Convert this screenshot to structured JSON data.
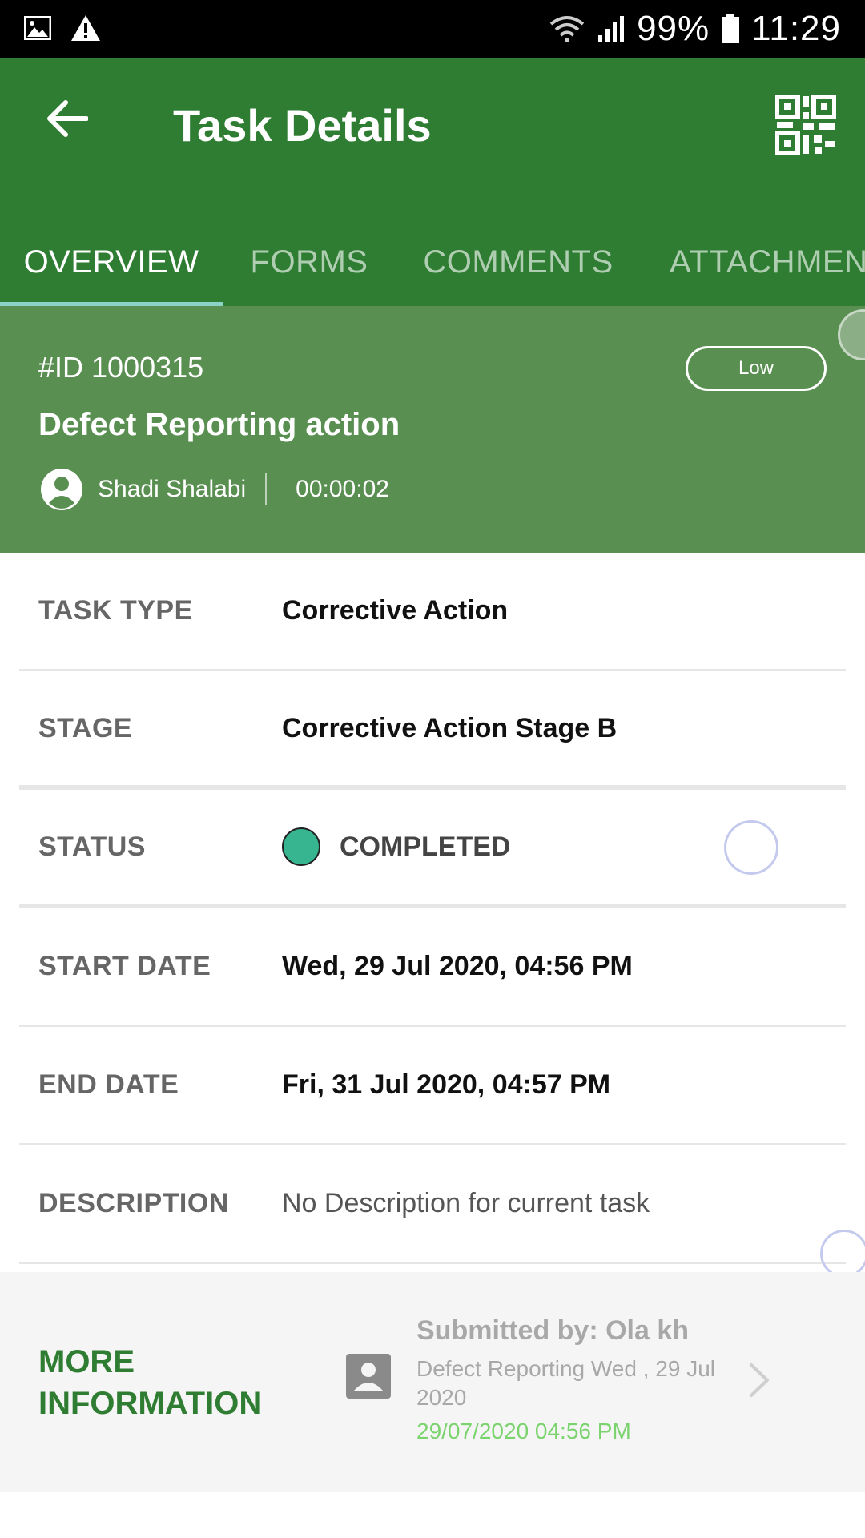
{
  "status_bar": {
    "battery": "99%",
    "time": "11:29",
    "icons": [
      "image-icon",
      "warning-icon",
      "wifi-icon",
      "signal-icon",
      "battery-icon"
    ]
  },
  "app_bar": {
    "title": "Task Details",
    "tabs": [
      {
        "label": "OVERVIEW",
        "active": true
      },
      {
        "label": "FORMS",
        "active": false
      },
      {
        "label": "COMMENTS",
        "active": false
      },
      {
        "label": "ATTACHMEN",
        "active": false
      }
    ]
  },
  "task": {
    "id": "#ID 1000315",
    "name": "Defect Reporting action",
    "priority": "Low",
    "owner": "Shadi Shalabi",
    "timer": "00:00:02"
  },
  "details": [
    {
      "label": "TASK TYPE",
      "value": "Corrective Action"
    },
    {
      "label": "STAGE",
      "value": "Corrective Action Stage B"
    },
    {
      "label": "STATUS",
      "value": "COMPLETED"
    },
    {
      "label": "START DATE",
      "value": "Wed, 29 Jul 2020, 04:56 PM"
    },
    {
      "label": "END DATE",
      "value": "Fri, 31 Jul 2020, 04:57 PM"
    },
    {
      "label": "DESCRIPTION",
      "value": "No Description for current task"
    }
  ],
  "more_info": {
    "label": "MORE INFORMATION",
    "submitted_by": "Submitted by: Ola kh",
    "description": "Defect Reporting Wed , 29 Jul 2020",
    "date": "29/07/2020 04:56 PM"
  },
  "colors": {
    "app_bar": "#2f7d32",
    "header_card": "#5a8f52",
    "tab_indicator": "#8bd3c7",
    "status_completed": "#36b590",
    "accent_green": "#2f7d32",
    "date_green": "#7bd36e"
  }
}
